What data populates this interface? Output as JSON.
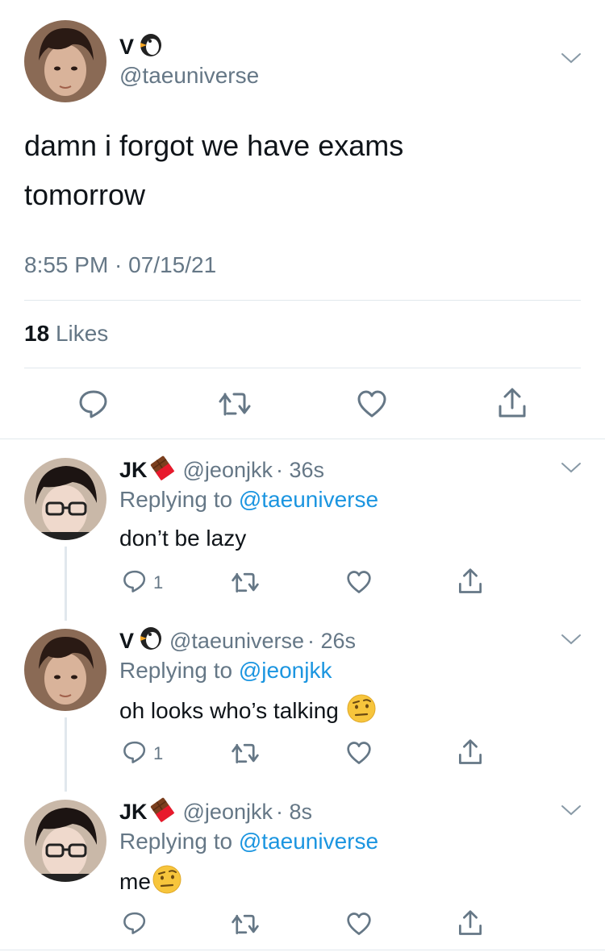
{
  "main_tweet": {
    "display_name": "V",
    "handle": "@taeuniverse",
    "text_line1": "damn i forgot we have exams",
    "text_line2": "tomorrow",
    "timestamp": "8:55 PM · 07/15/21",
    "likes_count": "18",
    "likes_label": "Likes"
  },
  "replies": [
    {
      "display_name": "JK",
      "handle": "@jeonjkk",
      "time": "· 36s",
      "replying_prefix": "Replying to",
      "replying_to": "@taeuniverse",
      "text": "don’t be lazy",
      "reply_count": "1"
    },
    {
      "display_name": "V",
      "handle": "@taeuniverse",
      "time": "· 26s",
      "replying_prefix": "Replying to",
      "replying_to": "@jeonjkk",
      "text": "oh looks who’s talking",
      "reply_count": "1"
    },
    {
      "display_name": "JK",
      "handle": "@jeonjkk",
      "time": "· 8s",
      "replying_prefix": "Replying to",
      "replying_to": "@taeuniverse",
      "text": "me",
      "reply_count": ""
    }
  ],
  "colors": {
    "link": "#1b95e0",
    "secondary": "#657786",
    "divider": "#e1e8ed"
  },
  "icons": [
    "penguin-emoji",
    "chocolate-emoji",
    "raised-eyebrow-emoji",
    "chevron-down-icon",
    "reply-icon",
    "retweet-icon",
    "heart-icon",
    "share-icon"
  ]
}
